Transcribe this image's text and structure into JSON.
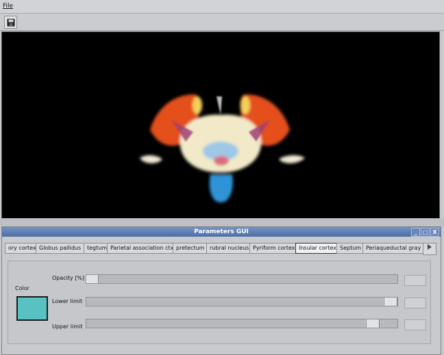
{
  "menu": {
    "file_label": "File"
  },
  "toolbar": {
    "save_icon": "floppy-disk-icon"
  },
  "viewport": {
    "background": "#000000",
    "render_colors": [
      "#e4501e",
      "#f1e9c8",
      "#2d94d6",
      "#f4d05a"
    ]
  },
  "panel": {
    "title": "Parameters GUI",
    "window_buttons": [
      "_",
      "□",
      "X"
    ],
    "tabs": [
      "ory cortex",
      "Globus pallidus",
      "tegtum",
      "Parietal association ctx",
      "pretectum",
      "rubral nucleus",
      "Pyriform cortex",
      "Insular cortex",
      "Septum",
      "Periaqueductal gray"
    ],
    "active_tab": "Insular cortex",
    "color_label": "Color",
    "color_value": "#58c2c3",
    "opacity_label": "Opacity [%]",
    "lower_label": "Lower limit",
    "upper_label": "Upper limit",
    "opacity_fraction": 0.0,
    "lower_fraction": 1.0,
    "upper_fraction": 0.94
  }
}
